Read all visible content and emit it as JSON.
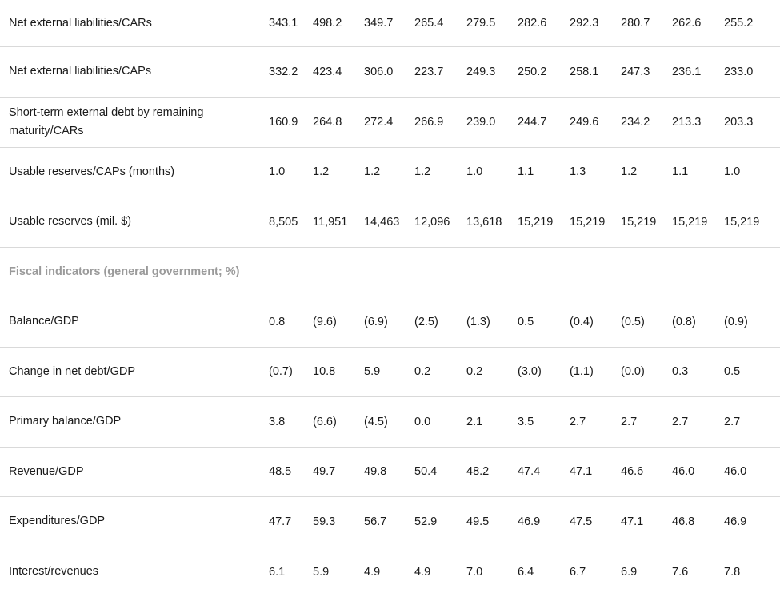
{
  "rows": [
    {
      "label": "Net external liabilities/CARs",
      "values": [
        "343.1",
        "498.2",
        "349.7",
        "265.4",
        "279.5",
        "282.6",
        "292.3",
        "280.7",
        "262.6",
        "255.2"
      ]
    },
    {
      "label": "Net external liabilities/CAPs",
      "values": [
        "332.2",
        "423.4",
        "306.0",
        "223.7",
        "249.3",
        "250.2",
        "258.1",
        "247.3",
        "236.1",
        "233.0"
      ]
    },
    {
      "label": "Short-term external debt by remaining maturity/CARs",
      "values": [
        "160.9",
        "264.8",
        "272.4",
        "266.9",
        "239.0",
        "244.7",
        "249.6",
        "234.2",
        "213.3",
        "203.3"
      ]
    },
    {
      "label": "Usable reserves/CAPs (months)",
      "values": [
        "1.0",
        "1.2",
        "1.2",
        "1.2",
        "1.0",
        "1.1",
        "1.3",
        "1.2",
        "1.1",
        "1.0"
      ]
    },
    {
      "label": "Usable reserves (mil. $)",
      "values": [
        "8,505",
        "11,951",
        "14,463",
        "12,096",
        "13,618",
        "15,219",
        "15,219",
        "15,219",
        "15,219",
        "15,219"
      ]
    },
    {
      "label": "Balance/GDP",
      "values": [
        "0.8",
        "(9.6)",
        "(6.9)",
        "(2.5)",
        "(1.3)",
        "0.5",
        "(0.4)",
        "(0.5)",
        "(0.8)",
        "(0.9)"
      ]
    },
    {
      "label": "Change in net debt/GDP",
      "values": [
        "(0.7)",
        "10.8",
        "5.9",
        "0.2",
        "0.2",
        "(3.0)",
        "(1.1)",
        "(0.0)",
        "0.3",
        "0.5"
      ]
    },
    {
      "label": "Primary balance/GDP",
      "values": [
        "3.8",
        "(6.6)",
        "(4.5)",
        "0.0",
        "2.1",
        "3.5",
        "2.7",
        "2.7",
        "2.7",
        "2.7"
      ]
    },
    {
      "label": "Revenue/GDP",
      "values": [
        "48.5",
        "49.7",
        "49.8",
        "50.4",
        "48.2",
        "47.4",
        "47.1",
        "46.6",
        "46.0",
        "46.0"
      ]
    },
    {
      "label": "Expenditures/GDP",
      "values": [
        "47.7",
        "59.3",
        "56.7",
        "52.9",
        "49.5",
        "46.9",
        "47.5",
        "47.1",
        "46.8",
        "46.9"
      ]
    },
    {
      "label": "Interest/revenues",
      "values": [
        "6.1",
        "5.9",
        "4.9",
        "4.9",
        "7.0",
        "6.4",
        "6.7",
        "6.9",
        "7.6",
        "7.8"
      ]
    }
  ],
  "section": {
    "label": "Fiscal indicators (general government; %)"
  }
}
